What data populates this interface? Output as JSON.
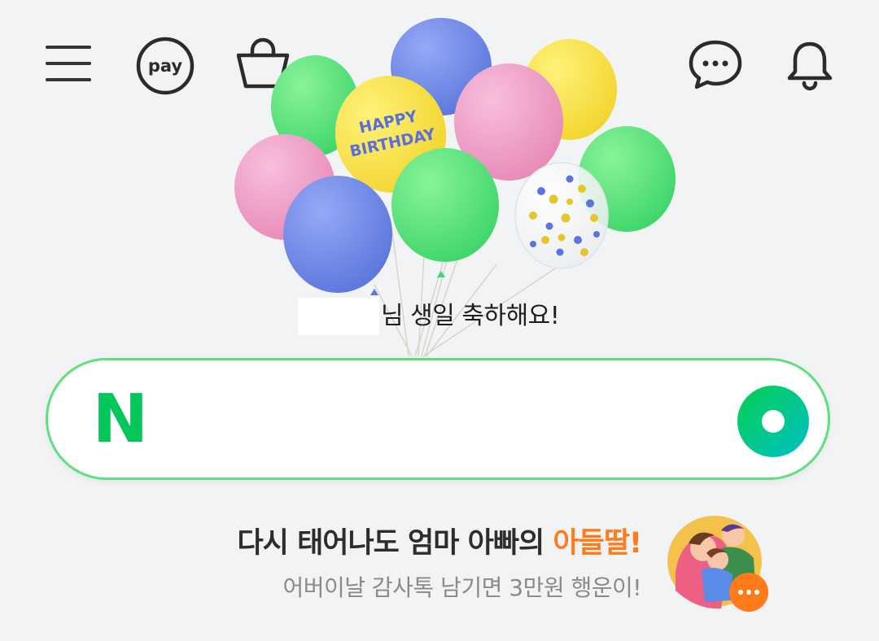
{
  "birthday": {
    "message": "님 생일 축하해요!"
  },
  "balloon": {
    "print_line1": "HAPPY",
    "print_line2": "BIRTHDAY"
  },
  "header": {
    "pay_label": "pay",
    "icons": [
      "menu-icon",
      "pay-icon",
      "shopping-bag-icon",
      "talk-icon",
      "bell-icon"
    ]
  },
  "search": {
    "logo_letter": "N",
    "value": "",
    "placeholder": ""
  },
  "promo": {
    "title_prefix": "다시 태어나도 엄마 아빠의 ",
    "title_accent": "아들딸!",
    "subtitle": "어버이날 감사톡 남기면 3만원 행운이!"
  },
  "colors": {
    "naver_green": "#03c75a",
    "accent_orange": "#ff7a1a",
    "search_border": "#5fe07f",
    "background": "#f2f3f5"
  }
}
